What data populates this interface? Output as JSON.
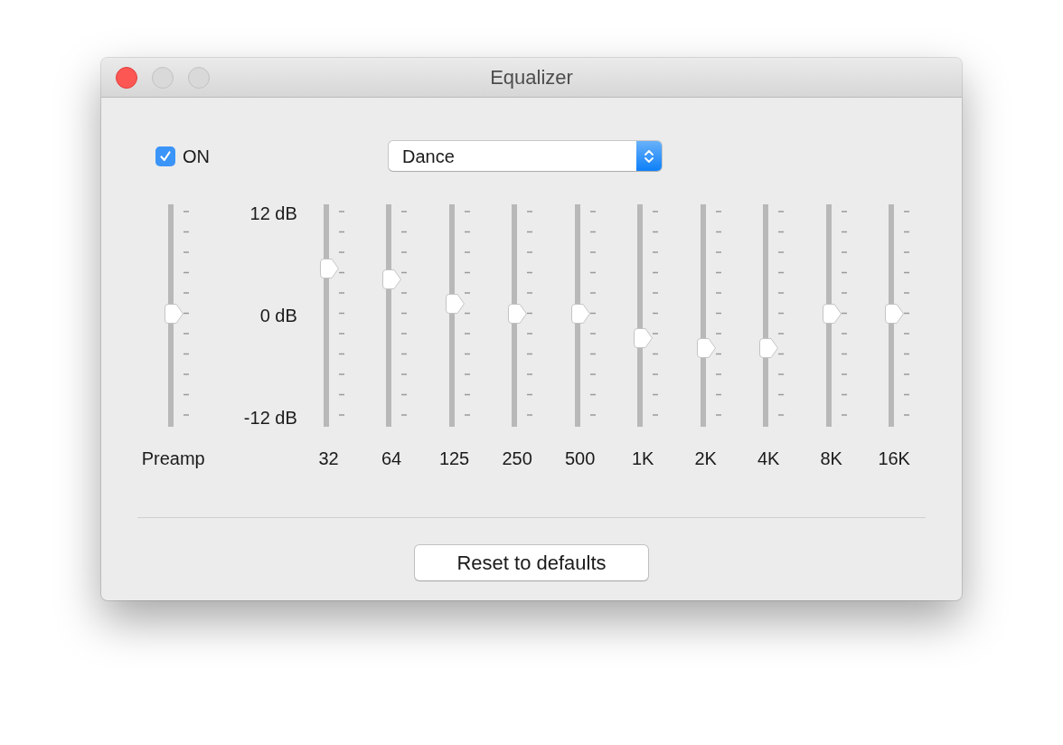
{
  "window": {
    "title": "Equalizer"
  },
  "enabled": {
    "label": "ON",
    "checked": true
  },
  "preset": {
    "value": "Dance"
  },
  "scale_labels": [
    "12 dB",
    "0 dB",
    "-12 dB"
  ],
  "preamp": {
    "label": "Preamp",
    "level": 0.5
  },
  "bands": [
    {
      "label": "32",
      "level": 0.72
    },
    {
      "label": "64",
      "level": 0.667
    },
    {
      "label": "125",
      "level": 0.547
    },
    {
      "label": "250",
      "level": 0.5
    },
    {
      "label": "500",
      "level": 0.5
    },
    {
      "label": "1K",
      "level": 0.378
    },
    {
      "label": "2K",
      "level": 0.329
    },
    {
      "label": "4K",
      "level": 0.329
    },
    {
      "label": "8K",
      "level": 0.5
    },
    {
      "label": "16K",
      "level": 0.5
    }
  ],
  "buttons": [
    {
      "label": "Reset to defaults"
    }
  ]
}
